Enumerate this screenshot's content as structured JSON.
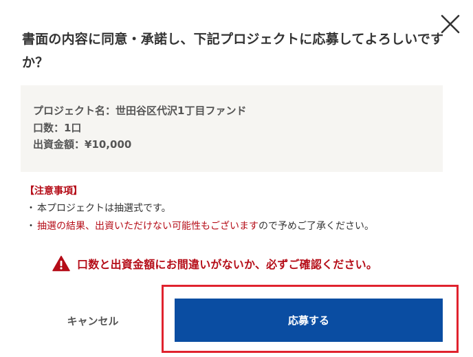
{
  "dialog": {
    "title": "書面の内容に同意・承諾し、下記プロジェクトに応募してよろしいですか？",
    "close_icon": "close-icon"
  },
  "summary": {
    "project_line": "プロジェクト名：世田谷区代沢1丁目ファンド",
    "units_line": "口数：1口",
    "amount_line": "出資金額：¥10,000"
  },
  "notes": {
    "title": "【注意事項】",
    "bullet": "・",
    "item1": "本プロジェクトは抽選式です。",
    "item2_red": "抽選の結果、出資いただけない可能性もございます",
    "item2_rest": "ので予めご了承ください。"
  },
  "warning": {
    "icon": "warning-triangle-icon",
    "text": "口数と出資金額にお間違いがないか、必ずご確認ください。"
  },
  "actions": {
    "cancel_label": "キャンセル",
    "apply_label": "応募する"
  },
  "colors": {
    "accent_red": "#b50d18",
    "primary_blue": "#0a4da2",
    "highlight_red": "#e0222e",
    "summary_bg": "#f6f5f2"
  }
}
